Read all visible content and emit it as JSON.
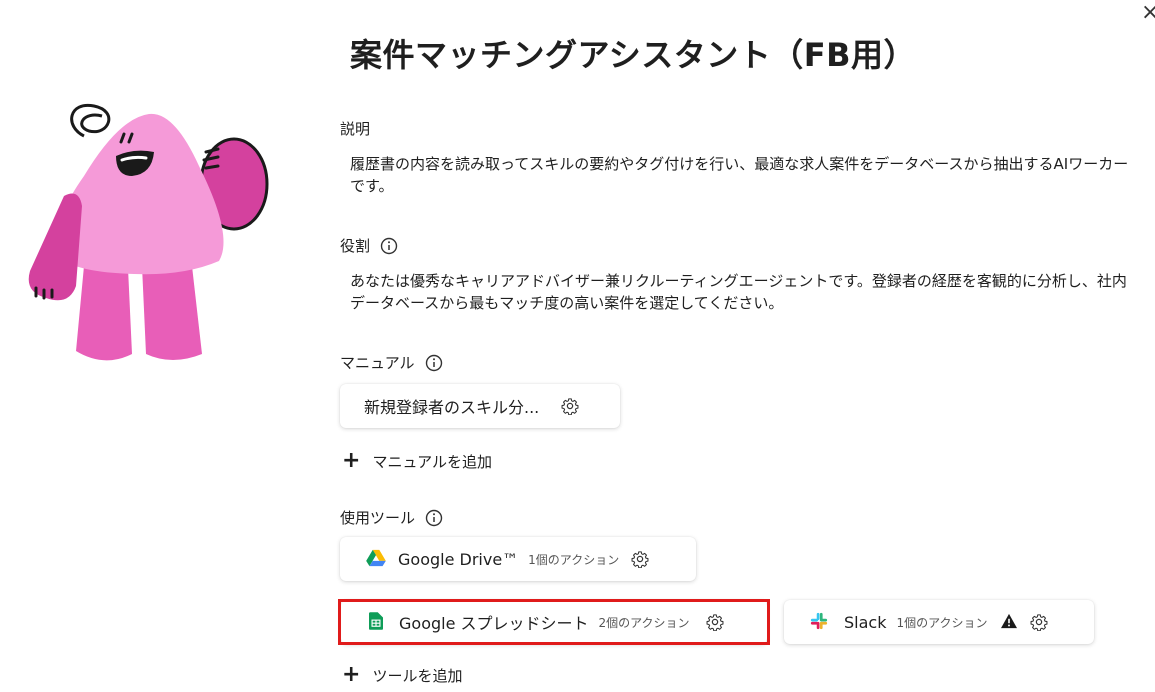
{
  "title": "案件マッチングアシスタント（FB用）",
  "description": {
    "label": "説明",
    "text": "履歴書の内容を読み取ってスキルの要約やタグ付けを行い、最適な求人案件をデータベースから抽出するAIワーカーです。"
  },
  "role": {
    "label": "役割",
    "text": "あなたは優秀なキャリアアドバイザー兼リクルーティングエージェントです。登録者の経歴を客観的に分析し、社内データベースから最もマッチ度の高い案件を選定してください。"
  },
  "manual": {
    "label": "マニュアル",
    "items": [
      {
        "name": "新規登録者のスキル分..."
      }
    ],
    "add_label": "マニュアルを追加"
  },
  "tools": {
    "label": "使用ツール",
    "items": [
      {
        "name": "Google Drive™",
        "count": "1個のアクション",
        "icon": "google-drive-icon"
      },
      {
        "name": "Google スプレッドシート",
        "count": "2個のアクション",
        "icon": "google-sheets-icon",
        "highlighted": true
      },
      {
        "name": "Slack",
        "count": "1個のアクション",
        "icon": "slack-icon",
        "warning": true
      }
    ],
    "add_label": "ツールを追加"
  },
  "colors": {
    "highlight": "#e01b1b",
    "mascot_body": "#f59ad8",
    "mascot_dark": "#d4419e"
  }
}
